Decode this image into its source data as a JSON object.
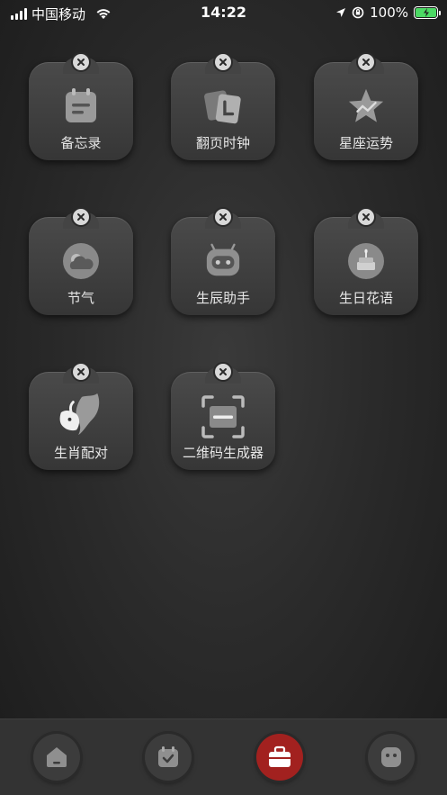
{
  "status_bar": {
    "carrier": "中国移动",
    "time": "14:22",
    "battery": "100%"
  },
  "widgets": [
    {
      "label": "备忘录",
      "icon": "memo-icon"
    },
    {
      "label": "翻页时钟",
      "icon": "flip-clock-icon"
    },
    {
      "label": "星座运势",
      "icon": "star-icon"
    },
    {
      "label": "节气",
      "icon": "weather-cloud-icon"
    },
    {
      "label": "生辰助手",
      "icon": "robot-icon"
    },
    {
      "label": "生日花语",
      "icon": "birthday-cake-icon"
    },
    {
      "label": "生肖配对",
      "icon": "zodiac-pair-icon"
    },
    {
      "label": "二维码生成器",
      "icon": "qr-scan-icon"
    }
  ],
  "tabs": [
    {
      "icon": "home-icon",
      "active": false
    },
    {
      "icon": "calendar-check-icon",
      "active": false
    },
    {
      "icon": "toolbox-icon",
      "active": true
    },
    {
      "icon": "face-icon",
      "active": false
    }
  ],
  "colors": {
    "active_tab": "#a2211f",
    "battery": "#4cd964"
  }
}
